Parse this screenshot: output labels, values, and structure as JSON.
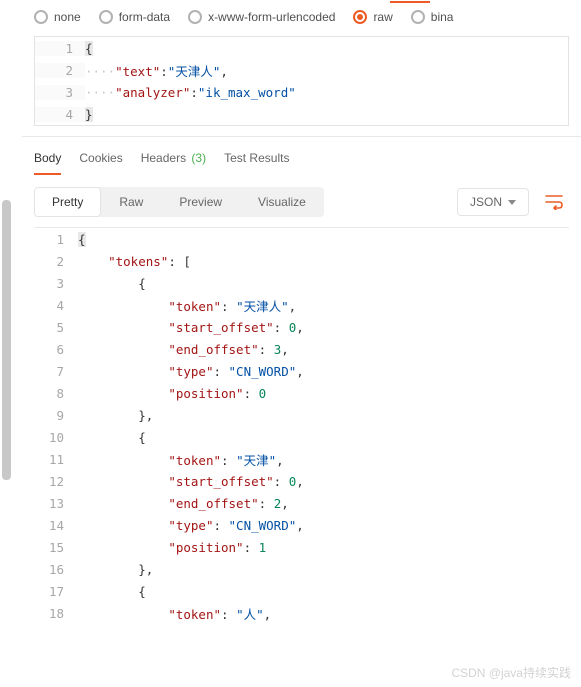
{
  "body_radios": {
    "none": "none",
    "formdata": "form-data",
    "urlenc": "x-www-form-urlencoded",
    "raw": "raw",
    "binary": "bina",
    "selected": "raw"
  },
  "request_editor": {
    "lines": [
      "1",
      "2",
      "3",
      "4"
    ],
    "l1": "{",
    "l2_dots": "····",
    "l2_key": "\"text\"",
    "l2_colon": ":",
    "l2_val": "\"天津人\"",
    "l2_comma": ",",
    "l3_dots": "····",
    "l3_key": "\"analyzer\"",
    "l3_colon": ":",
    "l3_val": "\"ik_max_word\"",
    "l4": "}"
  },
  "main_tabs": {
    "body": "Body",
    "cookies": "Cookies",
    "headers": "Headers",
    "headers_count": "(3)",
    "test": "Test Results"
  },
  "view_tabs": {
    "pretty": "Pretty",
    "raw": "Raw",
    "preview": "Preview",
    "visualize": "Visualize"
  },
  "format_dropdown": {
    "label": "JSON"
  },
  "response": {
    "ln": [
      "1",
      "2",
      "3",
      "4",
      "5",
      "6",
      "7",
      "8",
      "9",
      "10",
      "11",
      "12",
      "13",
      "14",
      "15",
      "16",
      "17",
      "18"
    ],
    "l1": "{",
    "l2_k": "\"tokens\"",
    "l2_c": ": [",
    "l3": "{",
    "l4_k": "\"token\"",
    "l4_v": "\"天津人\"",
    "l5_k": "\"start_offset\"",
    "l5_v": "0",
    "l6_k": "\"end_offset\"",
    "l6_v": "3",
    "l7_k": "\"type\"",
    "l7_v": "\"CN_WORD\"",
    "l8_k": "\"position\"",
    "l8_v": "0",
    "l9": "},",
    "l10": "{",
    "l11_k": "\"token\"",
    "l11_v": "\"天津\"",
    "l12_k": "\"start_offset\"",
    "l12_v": "0",
    "l13_k": "\"end_offset\"",
    "l13_v": "2",
    "l14_k": "\"type\"",
    "l14_v": "\"CN_WORD\"",
    "l15_k": "\"position\"",
    "l15_v": "1",
    "l16": "},",
    "l17": "{",
    "l18_k": "\"token\"",
    "l18_v": "\"人\"",
    "colon_c": ": ",
    "comma": ","
  },
  "watermark": "CSDN @java持续实践"
}
